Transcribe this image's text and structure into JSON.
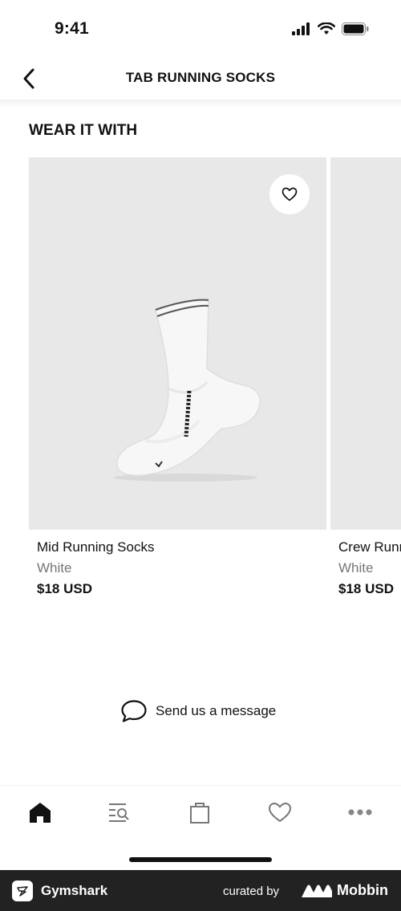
{
  "status_bar": {
    "time": "9:41",
    "icons": [
      "signal-icon",
      "wifi-icon",
      "battery-icon"
    ]
  },
  "header": {
    "title": "TAB RUNNING SOCKS",
    "back_icon": "chevron-left-icon"
  },
  "section": {
    "title": "WEAR IT WITH",
    "products": [
      {
        "name": "Mid Running Socks",
        "color": "White",
        "price": "$18 USD",
        "favorite_icon": "heart-outline-icon"
      },
      {
        "name": "Crew Running Socks",
        "color": "White",
        "price": "$18 USD"
      }
    ]
  },
  "message": {
    "label": "Send us a message",
    "icon": "chat-bubble-icon"
  },
  "tab_bar": {
    "items": [
      {
        "icon": "home-icon",
        "active": true
      },
      {
        "icon": "search-list-icon",
        "active": false
      },
      {
        "icon": "bag-icon",
        "active": false
      },
      {
        "icon": "heart-icon",
        "active": false
      },
      {
        "icon": "more-icon",
        "active": false
      }
    ]
  },
  "footer": {
    "app_name": "Gymshark",
    "curated_by": "curated by",
    "brand": "Mobbin"
  }
}
